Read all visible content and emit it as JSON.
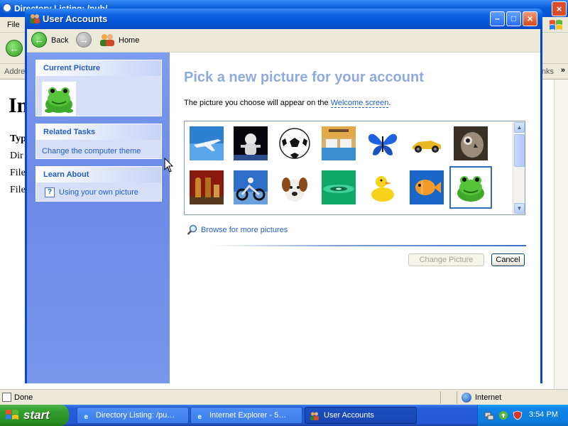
{
  "browser": {
    "title": "Directory Listing: /pub/…",
    "menu_file": "File",
    "address_label": "Address",
    "links_label": "Links",
    "more_chevron": "»",
    "page_heading": "In",
    "lines": [
      "Typ",
      "Dir",
      "File",
      "File"
    ],
    "status_done": "Done",
    "status_zone": "Internet"
  },
  "window": {
    "title": "User Accounts",
    "min_glyph": "–",
    "max_glyph": "□",
    "close_glyph": "×"
  },
  "toolbar": {
    "back_label": "Back",
    "back_glyph": "←",
    "forward_glyph": "→",
    "home_label": "Home"
  },
  "sidebar": {
    "current_picture_title": "Current Picture",
    "related_tasks_title": "Related Tasks",
    "related_tasks_item": "Change the computer theme",
    "learn_about_title": "Learn About",
    "learn_about_item": "Using your own picture",
    "help_glyph": "?"
  },
  "main": {
    "heading": "Pick a new picture for your account",
    "description_prefix": "The picture you choose will appear on the ",
    "description_link": "Welcome screen",
    "description_suffix": ".",
    "pictures": [
      {
        "name": "airplane"
      },
      {
        "name": "astronaut"
      },
      {
        "name": "soccer-ball"
      },
      {
        "name": "beach-chairs"
      },
      {
        "name": "butterfly"
      },
      {
        "name": "race-car"
      },
      {
        "name": "owl"
      },
      {
        "name": "chess"
      },
      {
        "name": "dirt-bike"
      },
      {
        "name": "dog"
      },
      {
        "name": "drop"
      },
      {
        "name": "duck"
      },
      {
        "name": "fish"
      },
      {
        "name": "frog",
        "selected": true
      }
    ],
    "browse_label": "Browse for more pictures",
    "change_picture_label": "Change Picture",
    "cancel_label": "Cancel"
  },
  "taskbar": {
    "start_label": "start",
    "tasks": [
      {
        "label": "Directory Listing: /pu…"
      },
      {
        "label": "Internet Explorer - 5…"
      },
      {
        "label": "User Accounts",
        "active": true
      }
    ],
    "clock": "3:54 PM"
  }
}
